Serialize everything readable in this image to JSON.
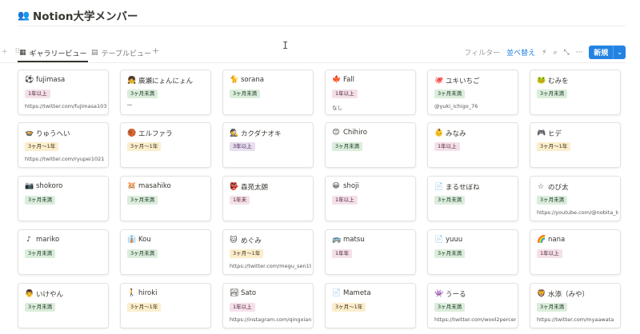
{
  "page": {
    "title_icon": "👥",
    "title": "Notion大学メンバー"
  },
  "tabs": [
    {
      "icon": "gallery-icon",
      "glyph": "▦",
      "label": "ギャラリービュー",
      "active": true
    },
    {
      "icon": "table-icon",
      "glyph": "▤",
      "label": "テーブルビュー",
      "active": false
    }
  ],
  "toolbar": {
    "add_view": "+",
    "filter": "フィルター",
    "sort": "並べ替え",
    "automation_glyph": "⚡",
    "search_glyph": "⌕",
    "more_glyph": "⤡",
    "settings_glyph": "···",
    "new": "新規",
    "new_chevron": "⌄"
  },
  "tag_colors": {
    "green": {
      "bg": "#dbeddb",
      "fg": "#1c3829"
    },
    "pink": {
      "bg": "#f5e0e9",
      "fg": "#4c2337"
    },
    "yellow": {
      "bg": "#fbeecc",
      "fg": "#402c1b"
    },
    "purple": {
      "bg": "#e8deee",
      "fg": "#412454"
    }
  },
  "cards": [
    {
      "icon": "⚽",
      "name": "fujimasa",
      "tag": "1年以上",
      "color": "pink",
      "note": "https://twitter.com/fujimasa1031"
    },
    {
      "icon": "👧",
      "name": "廣瀬にょんにょん",
      "tag": "3ヶ月未満",
      "color": "green",
      "note": "\"\""
    },
    {
      "icon": "🐈",
      "name": "sorana",
      "tag": "3ヶ月未満",
      "color": "green",
      "note": ""
    },
    {
      "icon": "🍁",
      "name": "Fall",
      "tag": "1年以上",
      "color": "pink",
      "note": "なし"
    },
    {
      "icon": "🐙",
      "name": "ユキいちご",
      "tag": "3ヶ月未満",
      "color": "green",
      "note": "@yuki_ichigo_76"
    },
    {
      "icon": "🐸",
      "name": "むみを",
      "tag": "3ヶ月未満",
      "color": "green",
      "note": ""
    },
    {
      "icon": "🍲",
      "name": "りゅうへい",
      "tag": "3ヶ月〜1年",
      "color": "yellow",
      "note": "https://twitter.com/ryupei1021"
    },
    {
      "icon": "🏀",
      "name": "エルファラ",
      "tag": "3ヶ月〜1年",
      "color": "yellow",
      "note": ""
    },
    {
      "icon": "🕵",
      "name": "カクダナオキ",
      "tag": "3年以上",
      "color": "purple",
      "note": ""
    },
    {
      "icon": "😊",
      "name": "Chihiro",
      "tag": "3ヶ月未満",
      "color": "green",
      "note": ""
    },
    {
      "icon": "👶",
      "name": "みなみ",
      "tag": "1年以上",
      "color": "pink",
      "note": ""
    },
    {
      "icon": "🎮",
      "name": "ヒデ",
      "tag": "3ヶ月〜1年",
      "color": "yellow",
      "note": ""
    },
    {
      "icon": "📷",
      "name": "shokoro",
      "tag": "3ヶ月未満",
      "color": "green",
      "note": ""
    },
    {
      "icon": "🐹",
      "name": "masahiko",
      "tag": "3ヶ月未満",
      "color": "green",
      "note": ""
    },
    {
      "icon": "👺",
      "name": "森苑太朗",
      "tag": "1年未",
      "color": "pink",
      "note": ""
    },
    {
      "icon": "😀",
      "name": "shoji",
      "tag": "1年以上",
      "color": "pink",
      "note": ""
    },
    {
      "icon": "📄",
      "name": "まるせぼね",
      "tag": "3ヶ月未満",
      "color": "green",
      "note": ""
    },
    {
      "icon": "☆",
      "name": "のび太",
      "tag": "3ヶ月未満",
      "color": "green",
      "note": "https://youtube.com/@nobita_tenis"
    },
    {
      "icon": "♪",
      "name": "mariko",
      "tag": "3ヶ月未満",
      "color": "green",
      "note": ""
    },
    {
      "icon": "👔",
      "name": "Kou",
      "tag": "3ヶ月未満",
      "color": "green",
      "note": ""
    },
    {
      "icon": "🐱",
      "name": "めぐみ",
      "tag": "3ヶ月〜1年",
      "color": "yellow",
      "note": "https://twitter.com/megu_sen19"
    },
    {
      "icon": "🚌",
      "name": "matsu",
      "tag": "1年年",
      "color": "pink",
      "note": ""
    },
    {
      "icon": "📄",
      "name": "yuuu",
      "tag": "3ヶ月未満",
      "color": "green",
      "note": ""
    },
    {
      "icon": "🌈",
      "name": "nana",
      "tag": "1年以上",
      "color": "pink",
      "note": ""
    },
    {
      "icon": "👨",
      "name": "いけやん",
      "tag": "3ヶ月未満",
      "color": "green",
      "note": ""
    },
    {
      "icon": "🚶",
      "name": "hiroki",
      "tag": "3ヶ月〜1年",
      "color": "yellow",
      "note": ""
    },
    {
      "icon": "🏞",
      "name": "Sato",
      "tag": "1年以上",
      "color": "pink",
      "note": "https://instagram.com/qingxiang6"
    },
    {
      "icon": "📄",
      "name": "Mameta",
      "tag": "3ヶ月〜1年",
      "color": "yellow",
      "note": ""
    },
    {
      "icon": "👾",
      "name": "うーる",
      "tag": "3ヶ月未満",
      "color": "green",
      "note": "https://twitter.com/wool2percent"
    },
    {
      "icon": "🦁",
      "name": "水添（みや）",
      "tag": "3ヶ月未満",
      "color": "green",
      "note": "https://twitter.com/myaawata"
    }
  ]
}
